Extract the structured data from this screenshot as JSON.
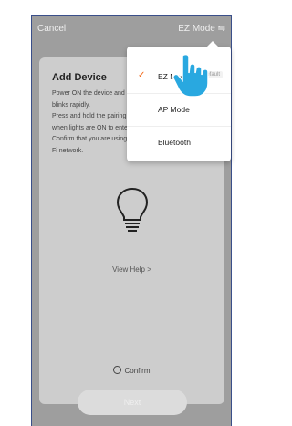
{
  "header": {
    "cancel_label": "Cancel",
    "mode_label": "EZ Mode ⇋"
  },
  "card": {
    "title": "Add Device",
    "instructions": [
      "Power ON the device and make sure the indicator light",
      "blinks rapidly.",
      "Press and hold the pairing button for about 5 seconds",
      "when lights are ON to enter pairing mode.",
      "Confirm that you are using a 2.4 GHz Wi-",
      "Fi network."
    ],
    "view_help": "View Help >",
    "confirm_label": "Confirm",
    "next_label": "Next"
  },
  "menu": {
    "items": [
      {
        "label": "EZ Mode",
        "badge": "Default",
        "selected": true
      },
      {
        "label": "AP Mode"
      },
      {
        "label": "Bluetooth"
      }
    ]
  },
  "colors": {
    "accent": "#f36b1c",
    "pointer": "#29a8e0"
  },
  "icons": {
    "bulb": "lightbulb-icon",
    "check": "checkmark-icon",
    "pointer": "hand-pointer-icon"
  }
}
